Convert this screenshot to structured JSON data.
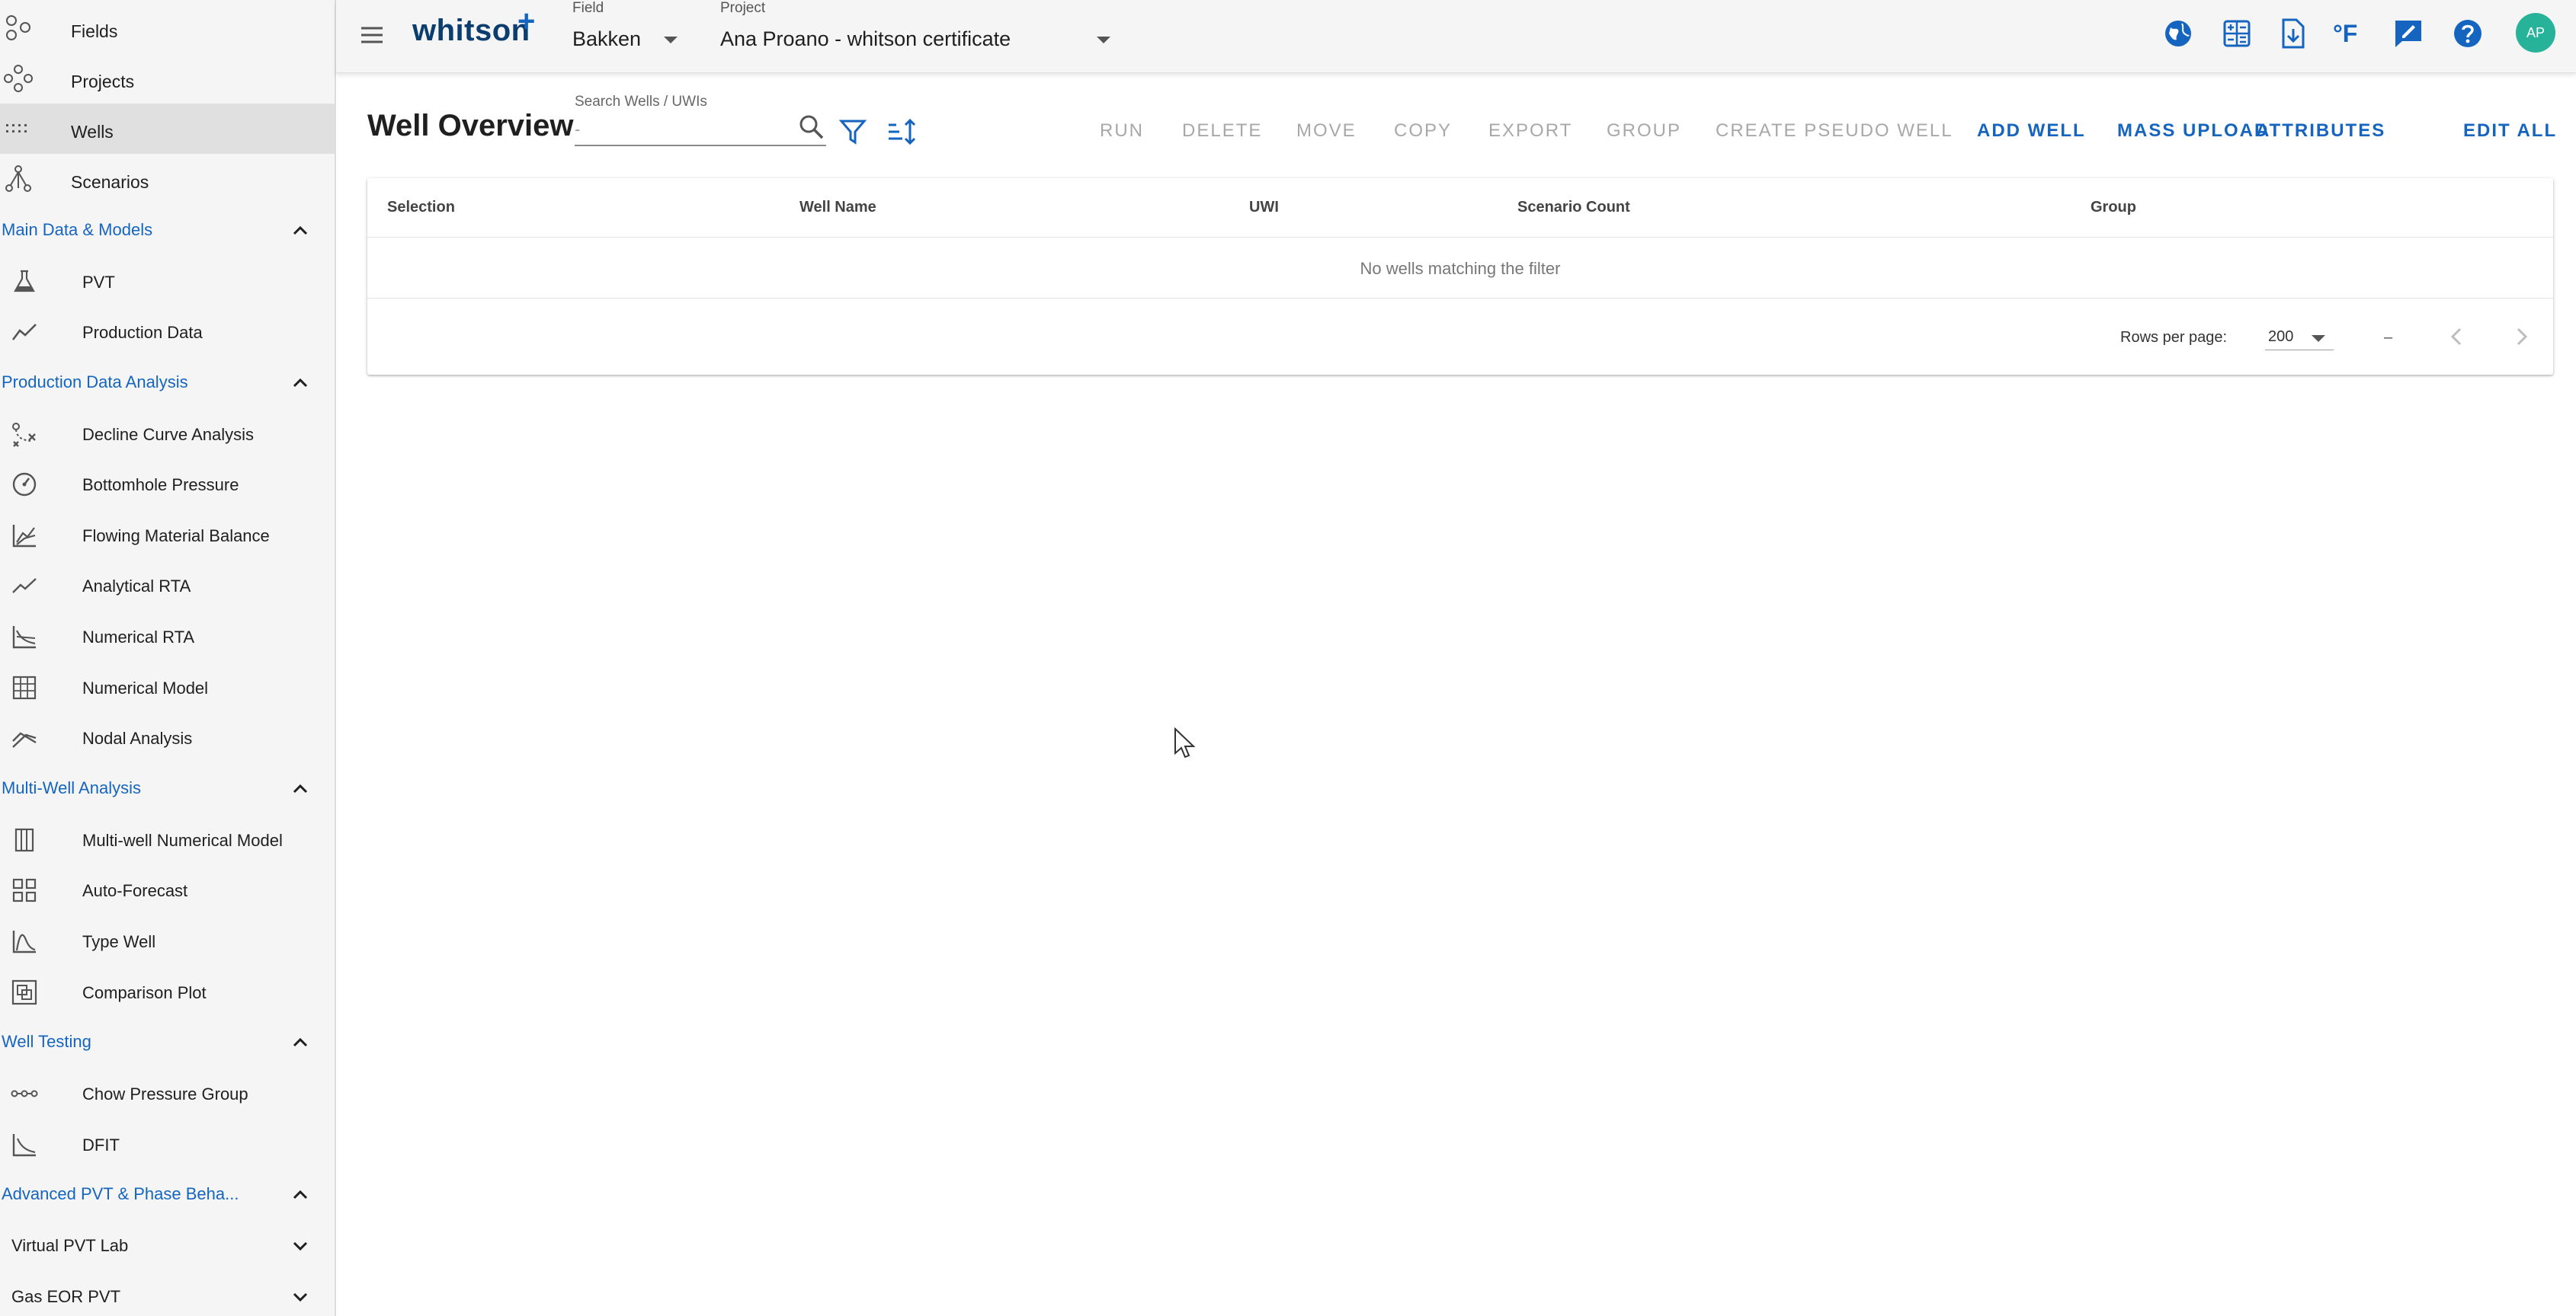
{
  "sidebar": {
    "top": [
      {
        "label": "Fields",
        "icon": "fields-icon"
      },
      {
        "label": "Projects",
        "icon": "projects-icon"
      },
      {
        "label": "Wells",
        "icon": "wells-icon",
        "active": true
      },
      {
        "label": "Scenarios",
        "icon": "scenarios-icon"
      }
    ],
    "sections": [
      {
        "title": "Main Data & Models",
        "items": [
          {
            "label": "PVT",
            "icon": "flask-icon"
          },
          {
            "label": "Production Data",
            "icon": "line-chart-icon"
          }
        ]
      },
      {
        "title": "Production Data Analysis",
        "items": [
          {
            "label": "Decline Curve Analysis",
            "icon": "decline-curve-icon"
          },
          {
            "label": "Bottomhole Pressure",
            "icon": "gauge-icon"
          },
          {
            "label": "Flowing Material Balance",
            "icon": "material-balance-icon"
          },
          {
            "label": "Analytical RTA",
            "icon": "trend-icon"
          },
          {
            "label": "Numerical RTA",
            "icon": "numerical-rta-icon"
          },
          {
            "label": "Numerical Model",
            "icon": "grid-model-icon"
          },
          {
            "label": "Nodal Analysis",
            "icon": "nodal-icon"
          }
        ]
      },
      {
        "title": "Multi-Well Analysis",
        "items": [
          {
            "label": "Multi-well Numerical Model",
            "icon": "columns-icon"
          },
          {
            "label": "Auto-Forecast",
            "icon": "dashboard-grid-icon"
          },
          {
            "label": "Type Well",
            "icon": "type-well-icon"
          },
          {
            "label": "Comparison Plot",
            "icon": "comparison-icon"
          }
        ]
      },
      {
        "title": "Well Testing",
        "items": [
          {
            "label": "Chow Pressure Group",
            "icon": "chow-icon"
          },
          {
            "label": "DFIT",
            "icon": "dfit-icon"
          }
        ]
      },
      {
        "title": "Advanced PVT & Phase Beha...",
        "items": []
      }
    ],
    "subsections": [
      {
        "label": "Virtual PVT Lab"
      },
      {
        "label": "Gas EOR PVT"
      }
    ]
  },
  "topbar": {
    "logo": "whitson",
    "logo_plus": "+",
    "field_label": "Field",
    "field_value": "Bakken",
    "project_label": "Project",
    "project_value": "Ana Proano - whitson certificate",
    "units_label": "°F",
    "avatar_initials": "AP",
    "icons": [
      "globe-icon",
      "calculator-icon",
      "download-icon",
      "units-icon",
      "feedback-icon",
      "help-icon"
    ]
  },
  "main": {
    "title": "Well Overview",
    "search": {
      "label": "Search Wells / UWIs",
      "placeholder": "-",
      "value": ""
    },
    "actions": [
      {
        "label": "RUN",
        "enabled": false
      },
      {
        "label": "DELETE",
        "enabled": false
      },
      {
        "label": "MOVE",
        "enabled": false
      },
      {
        "label": "COPY",
        "enabled": false
      },
      {
        "label": "EXPORT",
        "enabled": false
      },
      {
        "label": "GROUP",
        "enabled": false
      },
      {
        "label": "CREATE PSEUDO WELL",
        "enabled": false
      },
      {
        "label": "ADD WELL",
        "enabled": true
      },
      {
        "label": "MASS UPLOAD",
        "enabled": true
      },
      {
        "label": "ATTRIBUTES",
        "enabled": true
      },
      {
        "label": "EDIT ALL",
        "enabled": true
      }
    ],
    "table": {
      "columns": [
        "Selection",
        "Well Name",
        "UWI",
        "Scenario Count",
        "Group"
      ],
      "empty_message": "No wells matching the filter",
      "rows_per_page_label": "Rows per page:",
      "rows_per_page": "200",
      "range": "–"
    }
  },
  "colors": {
    "accent": "#1565c0",
    "avatar": "#26b39a",
    "sidebar_bg": "#f5f5f5",
    "active_bg": "#e0e0e0"
  }
}
